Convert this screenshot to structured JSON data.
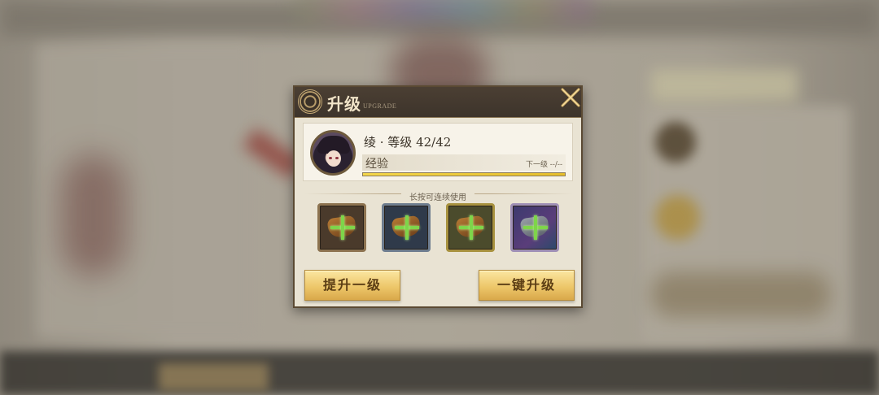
{
  "dialog": {
    "title": "升级",
    "subtitle": "UPGRADE",
    "close_icon": "close-x-icon"
  },
  "character": {
    "name_level": "绫 · 等级 42/42",
    "exp_label": "经验",
    "next_level_label": "下一级 --/--",
    "exp_progress": 1.0
  },
  "hint": "长按可连续使用",
  "items": [
    {
      "icon": "exp-material-icon",
      "rarity_color": "#8d7350"
    },
    {
      "icon": "exp-material-icon",
      "rarity_color": "#6e7d8f"
    },
    {
      "icon": "exp-material-icon",
      "rarity_color": "#a8923f"
    },
    {
      "icon": "exp-material-icon",
      "rarity_color": "#9f8fb6"
    }
  ],
  "buttons": {
    "upgrade_one": "提升一级",
    "upgrade_all": "一键升级"
  },
  "colors": {
    "accent_gold": "#edc76a",
    "exp_bar": "#f4d74a",
    "plus_green": "#7ed54a",
    "header_dark": "#3d342b"
  }
}
